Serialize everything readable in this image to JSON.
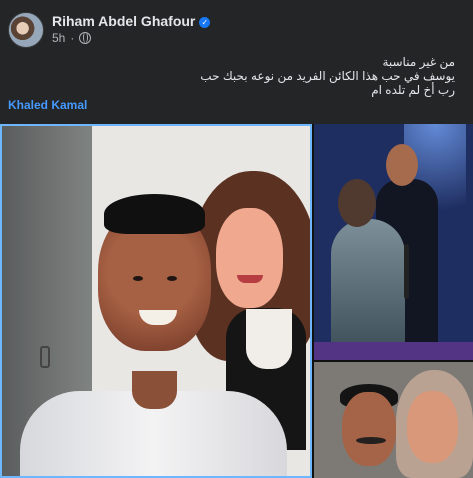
{
  "post": {
    "author": "Riham Abdel Ghafour",
    "time": "5h",
    "separator": "·",
    "text_lines": [
      "من غير مناسبة",
      "يوسف في حب هذا الكائن الفريد من نوعه بحبك حب",
      "رب أخ لم تلده ام"
    ],
    "mention": "Khaled Kamal"
  },
  "icons": {
    "verified": "verified-badge-icon",
    "privacy": "globe-icon"
  },
  "colors": {
    "background": "#242526",
    "text": "#e4e6eb",
    "secondary_text": "#b0b3b8",
    "link": "#4599ff",
    "selection": "#6eb7ff"
  }
}
